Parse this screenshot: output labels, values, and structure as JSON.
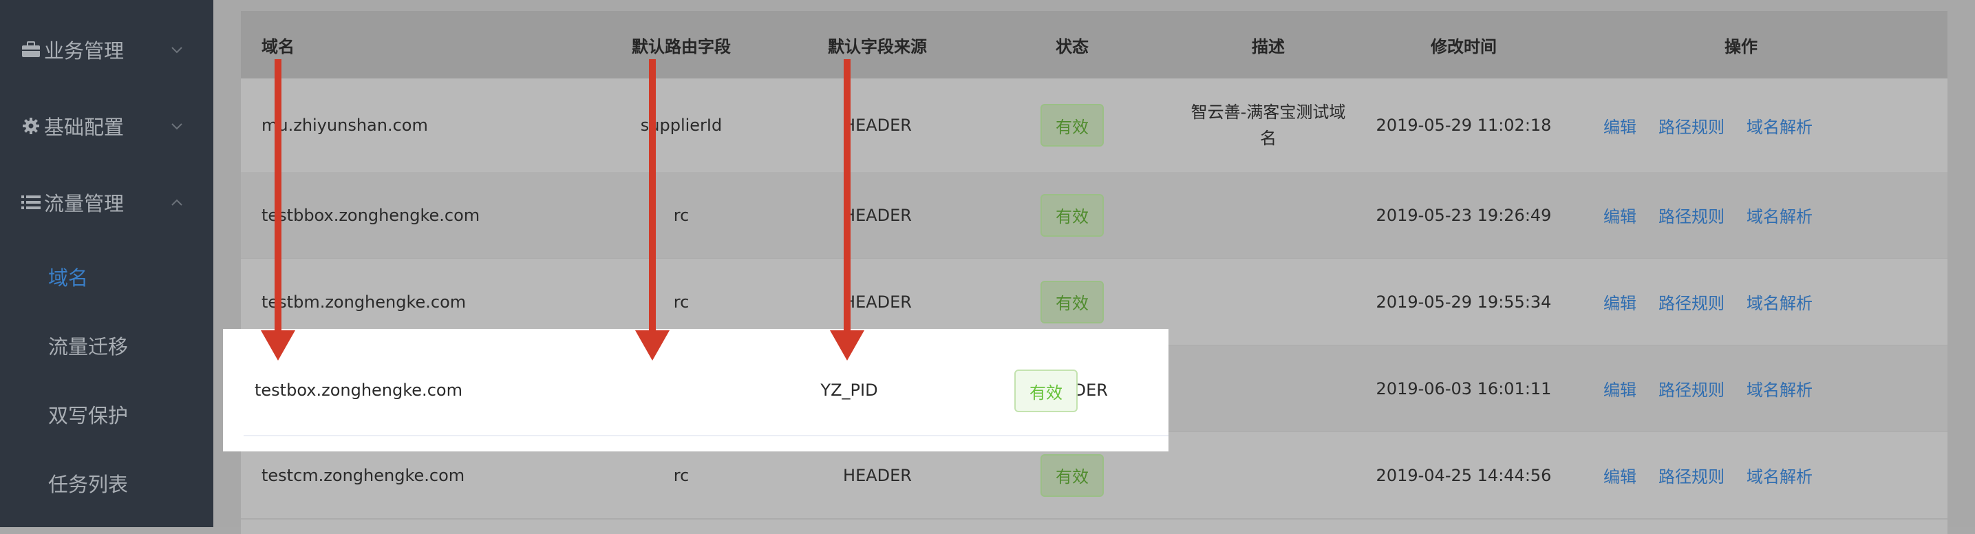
{
  "sidebar": {
    "groups": [
      {
        "label": "业务管理",
        "icon": "briefcase-icon"
      },
      {
        "label": "基础配置",
        "icon": "gear-icon"
      },
      {
        "label": "流量管理",
        "icon": "list-icon"
      }
    ],
    "sub_items": [
      {
        "label": "域名",
        "active": true
      },
      {
        "label": "流量迁移",
        "active": false
      },
      {
        "label": "双写保护",
        "active": false
      },
      {
        "label": "任务列表",
        "active": false
      }
    ]
  },
  "table": {
    "headers": {
      "domain": "域名",
      "route_field": "默认路由字段",
      "field_source": "默认字段来源",
      "status": "状态",
      "description": "描述",
      "modified": "修改时间",
      "actions": "操作"
    },
    "rows": [
      {
        "domain": "mu.zhiyunshan.com",
        "route_field": "supplierId",
        "field_source": "HEADER",
        "status": "有效",
        "description": "智云善-满客宝测试域名",
        "modified": "2019-05-29 11:02:18"
      },
      {
        "domain": "testbbox.zonghengke.com",
        "route_field": "rc",
        "field_source": "HEADER",
        "status": "有效",
        "description": "",
        "modified": "2019-05-23 19:26:49"
      },
      {
        "domain": "testbm.zonghengke.com",
        "route_field": "rc",
        "field_source": "HEADER",
        "status": "有效",
        "description": "",
        "modified": "2019-05-29 19:55:34"
      },
      {
        "domain": "testbox.zonghengke.com",
        "route_field": "YZ_PID",
        "field_source": "HEADER",
        "status": "有效",
        "description": "",
        "modified": "2019-06-03 16:01:11"
      },
      {
        "domain": "testcm.zonghengke.com",
        "route_field": "rc",
        "field_source": "HEADER",
        "status": "有效",
        "description": "",
        "modified": "2019-04-25 14:44:56"
      }
    ],
    "actions": {
      "edit": "编辑",
      "path_rules": "路径规则",
      "dns": "域名解析"
    }
  },
  "colors": {
    "sidebar_bg": "#2f3640",
    "active_menu": "#3a7fc8",
    "link": "#2f6db0",
    "status_green": "#67c23a",
    "arrow_red": "#d23a28"
  }
}
